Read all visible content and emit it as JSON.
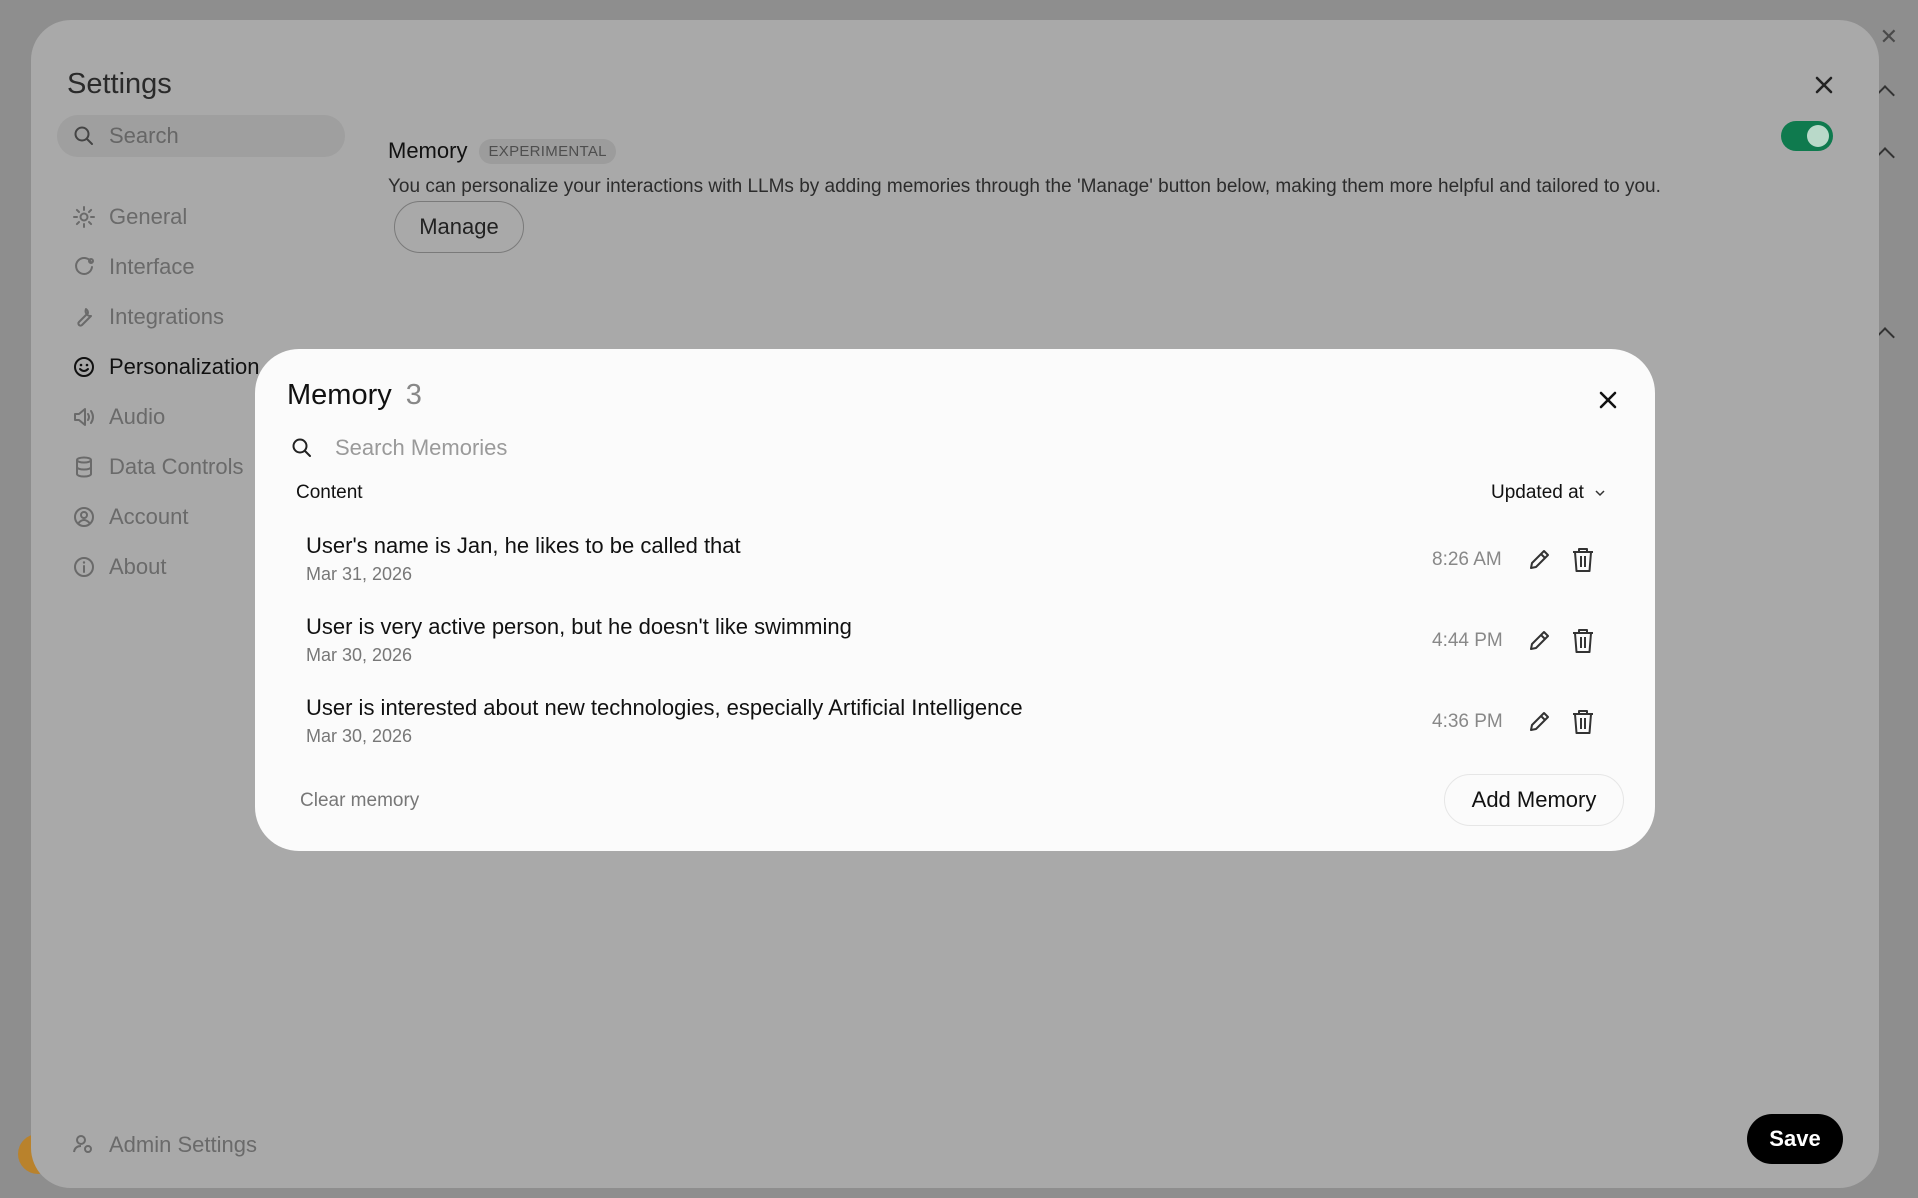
{
  "settings": {
    "title": "Settings",
    "search_placeholder": "Search",
    "nav": [
      {
        "label": "General",
        "icon": "gear-icon"
      },
      {
        "label": "Interface",
        "icon": "interface-icon"
      },
      {
        "label": "Integrations",
        "icon": "wrench-icon"
      },
      {
        "label": "Personalization",
        "icon": "smile-icon",
        "active": true
      },
      {
        "label": "Audio",
        "icon": "speaker-icon"
      },
      {
        "label": "Data Controls",
        "icon": "database-icon"
      },
      {
        "label": "Account",
        "icon": "user-circle-icon"
      },
      {
        "label": "About",
        "icon": "info-icon"
      }
    ],
    "admin_label": "Admin Settings",
    "memory_label": "Memory",
    "memory_badge": "EXPERIMENTAL",
    "memory_description": "You can personalize your interactions with LLMs by adding memories through the 'Manage' button below, making them more helpful and tailored to you.",
    "manage_label": "Manage",
    "memory_enabled": true,
    "save_label": "Save"
  },
  "modal": {
    "title": "Memory",
    "count": "3",
    "search_placeholder": "Search Memories",
    "col_content": "Content",
    "col_updated": "Updated at",
    "items": [
      {
        "content": "User's name is Jan, he likes to be called that",
        "date": "Mar 31, 2026",
        "time": "8:26 AM"
      },
      {
        "content": "User is very active person, but he doesn't like swimming",
        "date": "Mar 30, 2026",
        "time": "4:44 PM"
      },
      {
        "content": "User is interested about new technologies, especially Artificial Intelligence",
        "date": "Mar 30, 2026",
        "time": "4:36 PM"
      }
    ],
    "clear_label": "Clear memory",
    "add_label": "Add Memory"
  },
  "colors": {
    "toggle_on": "#0f7a4e",
    "save_bg": "#000000"
  }
}
